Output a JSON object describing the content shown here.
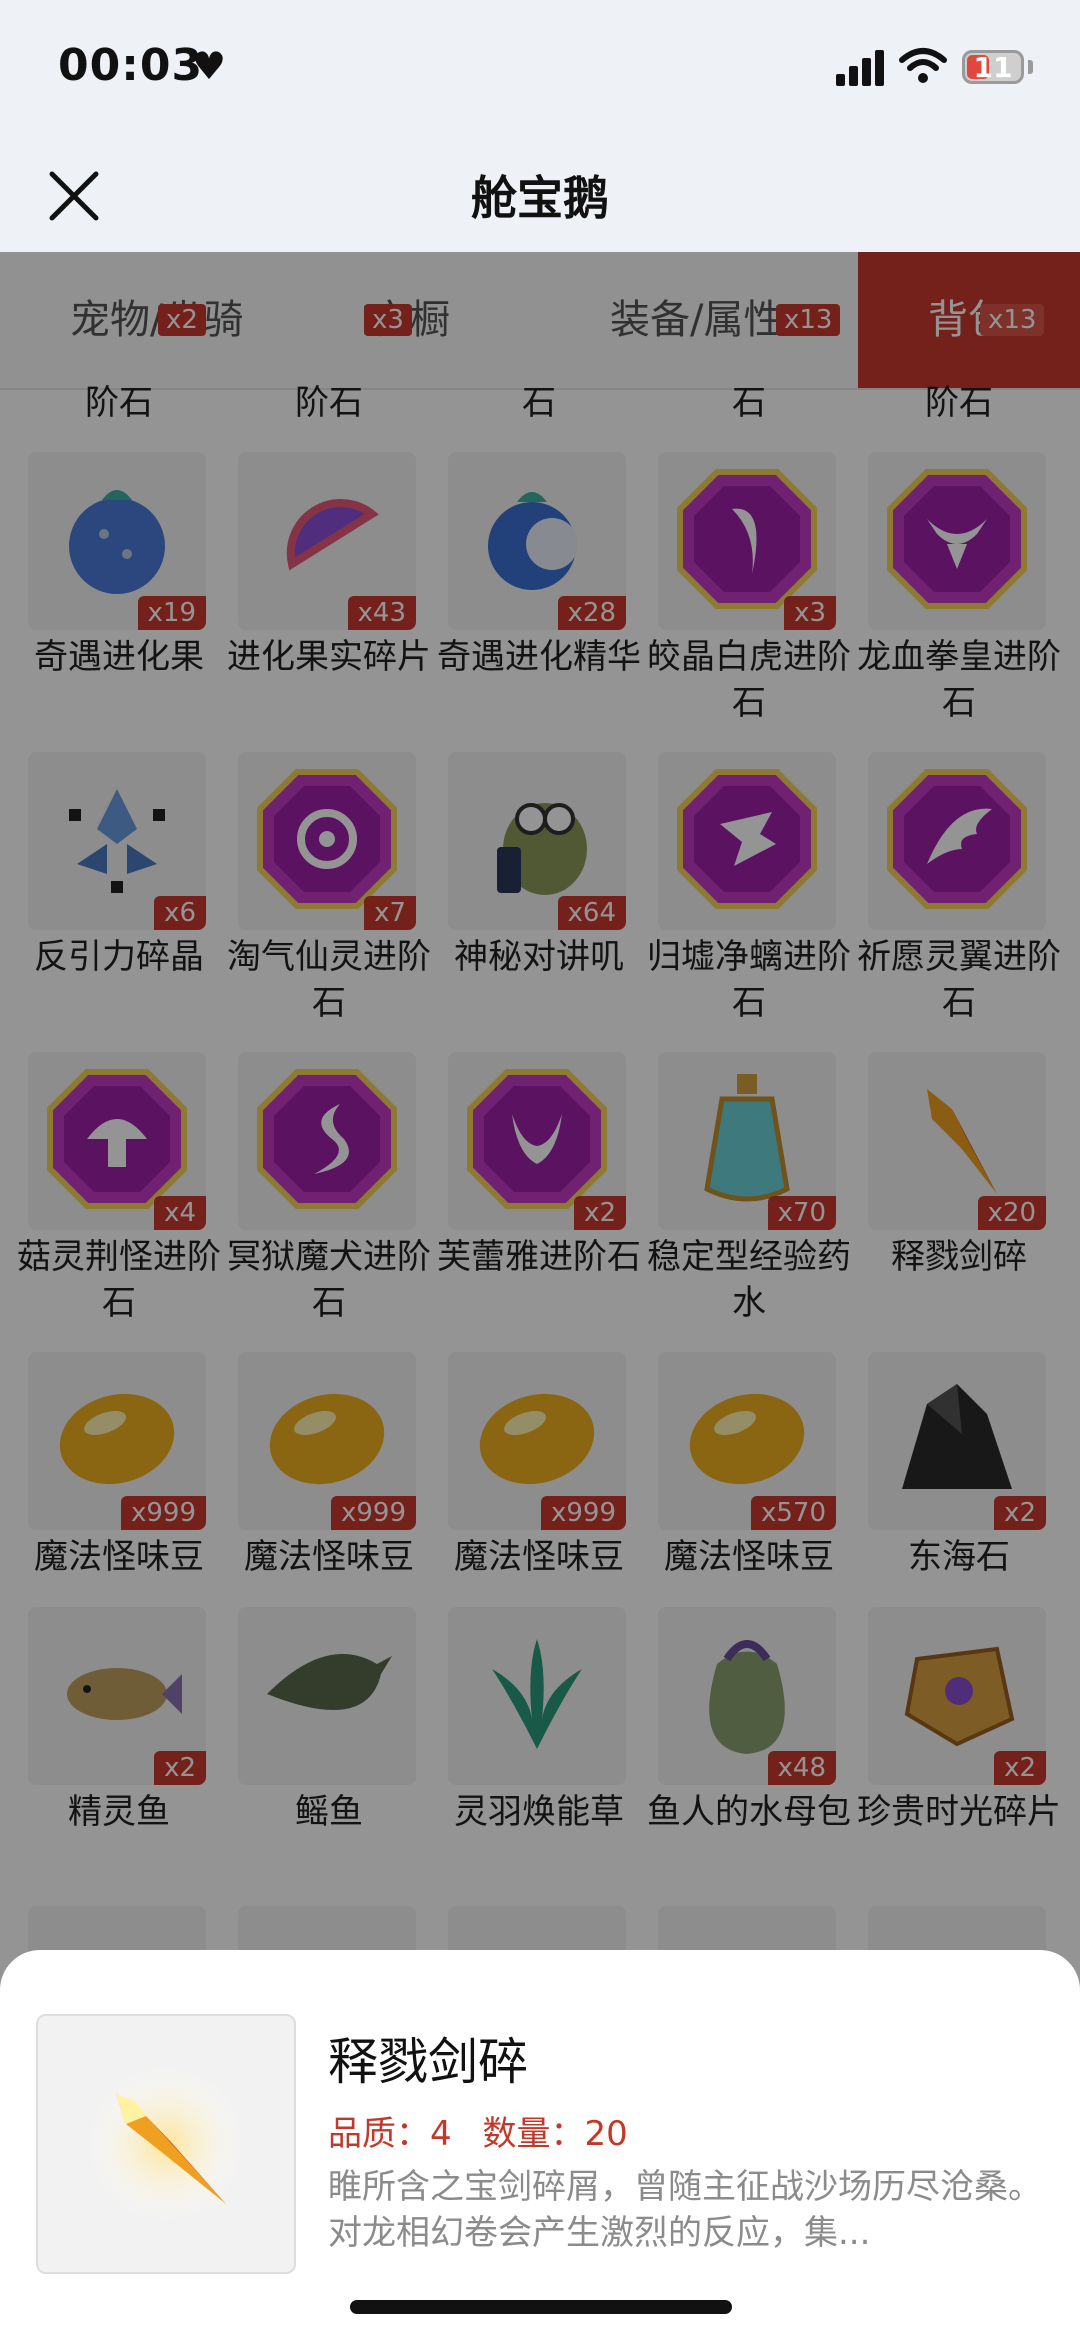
{
  "status": {
    "time": "00:03",
    "battery": "11"
  },
  "nav": {
    "title": "舱宝鹅"
  },
  "tabs": [
    {
      "label": "宠物/坐骑",
      "badge": "x2"
    },
    {
      "label": "衣橱",
      "badge": "x3"
    },
    {
      "label": "装备/属性",
      "badge": "x13"
    },
    {
      "label": "背包",
      "badge": "x13"
    }
  ],
  "partial_row": [
    "阶石",
    "阶石",
    "石",
    "石",
    "阶石"
  ],
  "items": [
    {
      "name": "奇遇进化果",
      "count": "x19",
      "icon": "blue-fruit-icon"
    },
    {
      "name": "进化果实碎片",
      "count": "x43",
      "icon": "fruit-slice-icon"
    },
    {
      "name": "奇遇进化精华",
      "count": "x28",
      "icon": "fruit-essence-icon"
    },
    {
      "name": "皎晶白虎进阶石",
      "count": "x3",
      "icon": "tiger-gem-icon"
    },
    {
      "name": "龙血拳皇进阶石",
      "count": "",
      "icon": "bull-gem-icon"
    },
    {
      "name": "反引力碎晶",
      "count": "x6",
      "icon": "antigravity-crystal-icon"
    },
    {
      "name": "淘气仙灵进阶石",
      "count": "x7",
      "icon": "fairy-gem-icon"
    },
    {
      "name": "神秘对讲叽",
      "count": "x64",
      "icon": "walkie-talkie-bird-icon"
    },
    {
      "name": "归墟净螭进阶石",
      "count": "",
      "icon": "dragon-gem-icon"
    },
    {
      "name": "祈愿灵翼进阶石",
      "count": "",
      "icon": "wing-gem-icon"
    },
    {
      "name": "菇灵荆怪进阶石",
      "count": "x4",
      "icon": "mushroom-gem-icon"
    },
    {
      "name": "冥狱魔犬进阶石",
      "count": "",
      "icon": "flame-gem-icon"
    },
    {
      "name": "芙蕾雅进阶石",
      "count": "x2",
      "icon": "horns-gem-icon"
    },
    {
      "name": "稳定型经验药水",
      "count": "x70",
      "icon": "potion-icon"
    },
    {
      "name": "释戮剑碎",
      "count": "x20",
      "icon": "sword-shard-icon"
    },
    {
      "name": "魔法怪味豆",
      "count": "x999",
      "icon": "bean-icon"
    },
    {
      "name": "魔法怪味豆",
      "count": "x999",
      "icon": "bean-icon"
    },
    {
      "name": "魔法怪味豆",
      "count": "x999",
      "icon": "bean-icon"
    },
    {
      "name": "魔法怪味豆",
      "count": "x570",
      "icon": "bean-icon"
    },
    {
      "name": "东海石",
      "count": "x2",
      "icon": "black-rock-icon"
    },
    {
      "name": "精灵鱼",
      "count": "x2",
      "icon": "fish-icon"
    },
    {
      "name": "鳐鱼",
      "count": "",
      "icon": "stingray-icon"
    },
    {
      "name": "灵羽焕能草",
      "count": "",
      "icon": "herb-icon"
    },
    {
      "name": "鱼人的水母包",
      "count": "x48",
      "icon": "jellyfish-bag-icon"
    },
    {
      "name": "珍贵时光碎片",
      "count": "x2",
      "icon": "time-fragment-icon"
    }
  ],
  "detail": {
    "name": "释戮剑碎",
    "quality_label": "品质：4",
    "count_label": "数量：20",
    "description": "睢所含之宝剑碎屑，曾随主征战沙场历尽沧桑。对龙相幻卷会产生激烈的反应，集..."
  },
  "colors": {
    "accent": "#c8382f",
    "gem_purple": "#b42ab8"
  }
}
